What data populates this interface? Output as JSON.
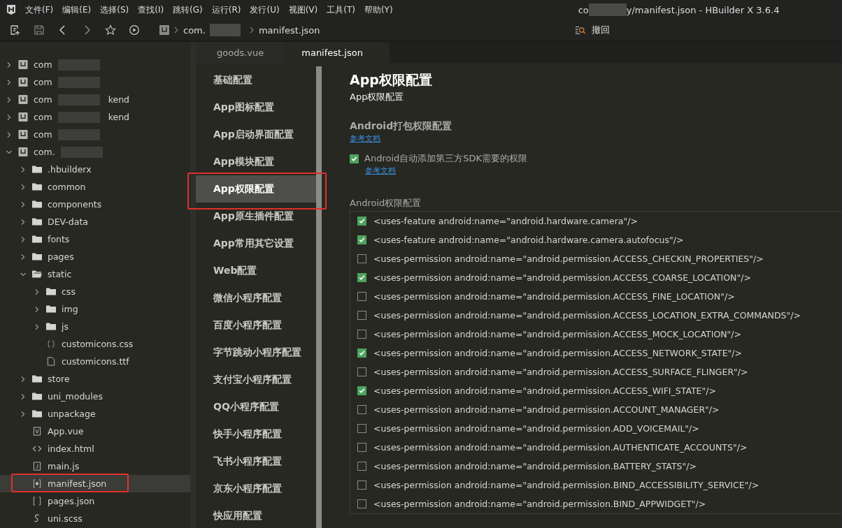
{
  "menu_bar": {
    "items": [
      "文件(F)",
      "编辑(E)",
      "选择(S)",
      "查找(I)",
      "跳转(G)",
      "运行(R)",
      "发行(U)",
      "视图(V)",
      "工具(T)",
      "帮助(Y)"
    ]
  },
  "window": {
    "title_start": "co",
    "title_end": "y/manifest.json - HBuilder X 3.6.4"
  },
  "toolbar": {
    "breadcrumb": [
      "com.",
      "manifest.json"
    ],
    "undo_label": "撤回"
  },
  "sidebar": {
    "tree": [
      {
        "label": "com",
        "kind": "project",
        "expanded": false,
        "selected": false,
        "annotated": false
      },
      {
        "label": "com",
        "kind": "project",
        "expanded": false,
        "selected": false,
        "annotated": false
      },
      {
        "label": "com",
        "suffix": "kend",
        "kind": "project",
        "expanded": false,
        "selected": false,
        "annotated": false
      },
      {
        "label": "com",
        "suffix": "kend",
        "kind": "project",
        "expanded": false,
        "selected": false,
        "annotated": false
      },
      {
        "label": "com",
        "kind": "project",
        "expanded": false,
        "selected": false,
        "annotated": false
      },
      {
        "label": "com.",
        "kind": "project",
        "expanded": true,
        "selected": false,
        "annotated": false,
        "children": [
          {
            "label": ".hbuilderx",
            "kind": "folder",
            "expanded": false,
            "selected": false,
            "annotated": false
          },
          {
            "label": "common",
            "kind": "folder",
            "expanded": false,
            "selected": false,
            "annotated": false
          },
          {
            "label": "components",
            "kind": "folder",
            "expanded": false,
            "selected": false,
            "annotated": false
          },
          {
            "label": "DEV-data",
            "kind": "folder",
            "expanded": false,
            "selected": false,
            "annotated": false
          },
          {
            "label": "fonts",
            "kind": "folder",
            "expanded": false,
            "selected": false,
            "annotated": false
          },
          {
            "label": "pages",
            "kind": "folder",
            "expanded": false,
            "selected": false,
            "annotated": false
          },
          {
            "label": "static",
            "kind": "folder",
            "expanded": true,
            "selected": false,
            "annotated": false,
            "children": [
              {
                "label": "css",
                "kind": "folder",
                "expanded": false,
                "selected": false,
                "annotated": false
              },
              {
                "label": "img",
                "kind": "folder",
                "expanded": false,
                "selected": false,
                "annotated": false
              },
              {
                "label": "js",
                "kind": "folder",
                "expanded": false,
                "selected": false,
                "annotated": false
              },
              {
                "label": "customicons.css",
                "kind": "css",
                "selected": false,
                "annotated": false
              },
              {
                "label": "customicons.ttf",
                "kind": "file",
                "selected": false,
                "annotated": false
              }
            ]
          },
          {
            "label": "store",
            "kind": "folder",
            "expanded": false,
            "selected": false,
            "annotated": false
          },
          {
            "label": "uni_modules",
            "kind": "folder",
            "expanded": false,
            "selected": false,
            "annotated": false
          },
          {
            "label": "unpackage",
            "kind": "folder",
            "expanded": false,
            "selected": false,
            "annotated": false
          },
          {
            "label": "App.vue",
            "kind": "vue",
            "selected": false,
            "annotated": false
          },
          {
            "label": "index.html",
            "kind": "html",
            "selected": false,
            "annotated": false
          },
          {
            "label": "main.js",
            "kind": "js",
            "selected": false,
            "annotated": false
          },
          {
            "label": "manifest.json",
            "kind": "manifest",
            "selected": true,
            "annotated": true
          },
          {
            "label": "pages.json",
            "kind": "json",
            "selected": false,
            "annotated": false
          },
          {
            "label": "uni.scss",
            "kind": "scss",
            "selected": false,
            "annotated": false
          }
        ]
      }
    ]
  },
  "tabs": [
    {
      "label": "goods.vue",
      "selected": false
    },
    {
      "label": "manifest.json",
      "selected": true
    }
  ],
  "config_menu": [
    {
      "label": "基础配置",
      "selected": false,
      "annotated": false
    },
    {
      "label": "App图标配置",
      "selected": false,
      "annotated": false
    },
    {
      "label": "App启动界面配置",
      "selected": false,
      "annotated": false
    },
    {
      "label": "App模块配置",
      "selected": false,
      "annotated": false
    },
    {
      "label": "App权限配置",
      "selected": true,
      "annotated": true
    },
    {
      "label": "App原生插件配置",
      "selected": false,
      "annotated": false
    },
    {
      "label": "App常用其它设置",
      "selected": false,
      "annotated": false
    },
    {
      "label": "Web配置",
      "selected": false,
      "annotated": false
    },
    {
      "label": "微信小程序配置",
      "selected": false,
      "annotated": false
    },
    {
      "label": "百度小程序配置",
      "selected": false,
      "annotated": false
    },
    {
      "label": "字节跳动小程序配置",
      "selected": false,
      "annotated": false
    },
    {
      "label": "支付宝小程序配置",
      "selected": false,
      "annotated": false
    },
    {
      "label": "QQ小程序配置",
      "selected": false,
      "annotated": false
    },
    {
      "label": "快手小程序配置",
      "selected": false,
      "annotated": false
    },
    {
      "label": "飞书小程序配置",
      "selected": false,
      "annotated": false
    },
    {
      "label": "京东小程序配置",
      "selected": false,
      "annotated": false
    },
    {
      "label": "快应用配置",
      "selected": false,
      "annotated": false
    }
  ],
  "content": {
    "title": "App权限配置",
    "subtitle": "App权限配置",
    "android_section": {
      "heading": "Android打包权限配置",
      "doc_link": "参考文档",
      "auto_sdk": {
        "label": "Android自动添加第三方SDK需要的权限",
        "checked": true,
        "doc_link": "参考文档"
      }
    },
    "permissions_label": "Android权限配置",
    "permissions": [
      {
        "text": "<uses-feature android:name=\"android.hardware.camera\"/>",
        "checked": true
      },
      {
        "text": "<uses-feature android:name=\"android.hardware.camera.autofocus\"/>",
        "checked": true
      },
      {
        "text": "<uses-permission android:name=\"android.permission.ACCESS_CHECKIN_PROPERTIES\"/>",
        "checked": false
      },
      {
        "text": "<uses-permission android:name=\"android.permission.ACCESS_COARSE_LOCATION\"/>",
        "checked": true
      },
      {
        "text": "<uses-permission android:name=\"android.permission.ACCESS_FINE_LOCATION\"/>",
        "checked": false
      },
      {
        "text": "<uses-permission android:name=\"android.permission.ACCESS_LOCATION_EXTRA_COMMANDS\"/>",
        "checked": false
      },
      {
        "text": "<uses-permission android:name=\"android.permission.ACCESS_MOCK_LOCATION\"/>",
        "checked": false
      },
      {
        "text": "<uses-permission android:name=\"android.permission.ACCESS_NETWORK_STATE\"/>",
        "checked": true
      },
      {
        "text": "<uses-permission android:name=\"android.permission.ACCESS_SURFACE_FLINGER\"/>",
        "checked": false
      },
      {
        "text": "<uses-permission android:name=\"android.permission.ACCESS_WIFI_STATE\"/>",
        "checked": true
      },
      {
        "text": "<uses-permission android:name=\"android.permission.ACCOUNT_MANAGER\"/>",
        "checked": false
      },
      {
        "text": "<uses-permission android:name=\"android.permission.ADD_VOICEMAIL\"/>",
        "checked": false
      },
      {
        "text": "<uses-permission android:name=\"android.permission.AUTHENTICATE_ACCOUNTS\"/>",
        "checked": false
      },
      {
        "text": "<uses-permission android:name=\"android.permission.BATTERY_STATS\"/>",
        "checked": false
      },
      {
        "text": "<uses-permission android:name=\"android.permission.BIND_ACCESSIBILITY_SERVICE\"/>",
        "checked": false
      },
      {
        "text": "<uses-permission android:name=\"android.permission.BIND_APPWIDGET\"/>",
        "checked": false
      }
    ]
  }
}
